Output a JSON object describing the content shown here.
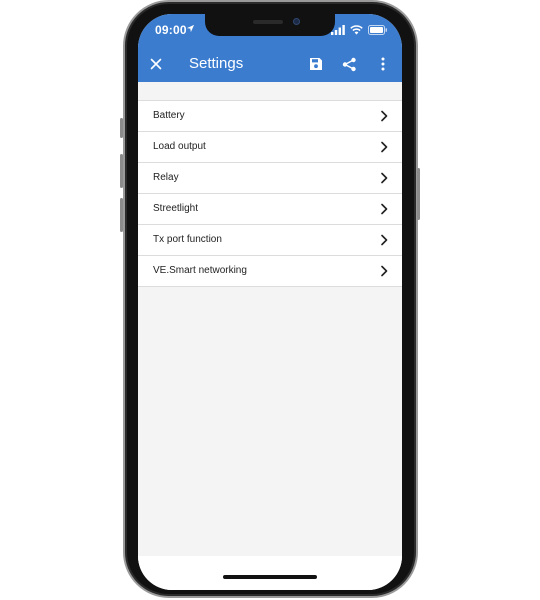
{
  "status_bar": {
    "time": "09:00",
    "icons": [
      "location-icon",
      "signal-icon",
      "wifi-icon",
      "battery-icon"
    ]
  },
  "toolbar": {
    "close_icon": "close-icon",
    "title": "Settings",
    "actions": [
      "save-icon",
      "share-icon",
      "more-vert-icon"
    ]
  },
  "settings": {
    "items": [
      {
        "label": "Battery"
      },
      {
        "label": "Load output"
      },
      {
        "label": "Relay"
      },
      {
        "label": "Streetlight"
      },
      {
        "label": "Tx port function"
      },
      {
        "label": "VE.Smart networking"
      }
    ]
  },
  "colors": {
    "accent": "#3b7ccf",
    "background": "#f4f4f4"
  }
}
